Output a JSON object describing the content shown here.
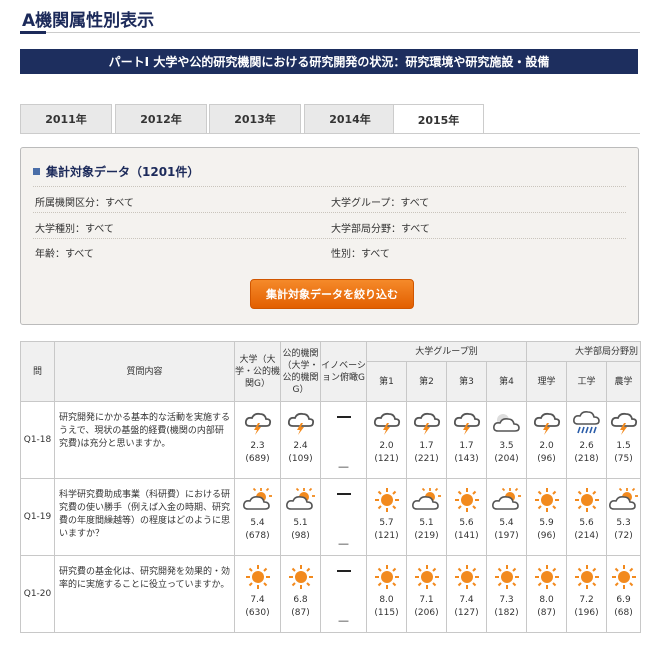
{
  "page": {
    "title": "A機関属性別表示",
    "banner": "パートI 大学や公的研究機関における研究開発の状況：研究環境や研究施設・設備"
  },
  "tabs": [
    {
      "label": "2011年",
      "active": false
    },
    {
      "label": "2012年",
      "active": false
    },
    {
      "label": "2013年",
      "active": false
    },
    {
      "label": "2014年",
      "active": false
    },
    {
      "label": "2015年",
      "active": true
    }
  ],
  "filters": {
    "heading": "集計対象データ（1201件）",
    "criteria": [
      "所属機関区分：すべて",
      "大学グループ：すべて",
      "大学種別：すべて",
      "大学部局分野：すべて",
      "年齢：すべて",
      "性別：すべて"
    ],
    "button": "集計対象データを絞り込む"
  },
  "table": {
    "headers": {
      "q": "問",
      "content": "質問内容",
      "univ": "大学（大学・公的機関G）",
      "public": "公的機関（大学・公的機関G）",
      "innov": "イノベーション俯瞰G",
      "group": "大学グループ別",
      "dept": "大学部局分野別",
      "g1": "第1",
      "g2": "第2",
      "g3": "第3",
      "g4": "第4",
      "d1": "理学",
      "d2": "工学",
      "d3": "農学"
    },
    "rows": [
      {
        "id": "Q1-18",
        "text": "研究開発にかかる基本的な活動を実施するうえで、現状の基盤的経費(機関の内部研究費)は充分と思いますか。",
        "cells": [
          {
            "icon": "thunder",
            "score": "2.3",
            "n": "(689)"
          },
          {
            "icon": "thunder",
            "score": "2.4",
            "n": "(109)"
          },
          {
            "icon": "none",
            "score": "—"
          },
          {
            "icon": "thunder",
            "score": "2.0",
            "n": "(121)"
          },
          {
            "icon": "thunder",
            "score": "1.7",
            "n": "(221)"
          },
          {
            "icon": "thunder",
            "score": "1.7",
            "n": "(143)"
          },
          {
            "icon": "cloud",
            "score": "3.5",
            "n": "(204)"
          },
          {
            "icon": "thunder",
            "score": "2.0",
            "n": "(96)"
          },
          {
            "icon": "rain",
            "score": "2.6",
            "n": "(218)"
          },
          {
            "icon": "thunder",
            "score": "1.5",
            "n": "(75)"
          }
        ]
      },
      {
        "id": "Q1-19",
        "text": "科学研究費助成事業（科研費）における研究費の使い勝手（例えば入金の時期、研究費の年度間繰越等）の程度はどのように思いますか？",
        "cells": [
          {
            "icon": "suncloud",
            "score": "5.4",
            "n": "(678)"
          },
          {
            "icon": "suncloud",
            "score": "5.1",
            "n": "(98)"
          },
          {
            "icon": "none",
            "score": "—"
          },
          {
            "icon": "sun",
            "score": "5.7",
            "n": "(121)"
          },
          {
            "icon": "suncloud",
            "score": "5.1",
            "n": "(219)"
          },
          {
            "icon": "sun",
            "score": "5.6",
            "n": "(141)"
          },
          {
            "icon": "suncloud",
            "score": "5.4",
            "n": "(197)"
          },
          {
            "icon": "sun",
            "score": "5.9",
            "n": "(96)"
          },
          {
            "icon": "sun",
            "score": "5.6",
            "n": "(214)"
          },
          {
            "icon": "suncloud",
            "score": "5.3",
            "n": "(72)"
          }
        ]
      },
      {
        "id": "Q1-20",
        "text": "研究費の基金化は、研究開発を効果的・効率的に実施することに役立っていますか。",
        "cells": [
          {
            "icon": "sun",
            "score": "7.4",
            "n": "(630)"
          },
          {
            "icon": "sun",
            "score": "6.8",
            "n": "(87)"
          },
          {
            "icon": "none",
            "score": "—"
          },
          {
            "icon": "sun",
            "score": "8.0",
            "n": "(115)"
          },
          {
            "icon": "sun",
            "score": "7.1",
            "n": "(206)"
          },
          {
            "icon": "sun",
            "score": "7.4",
            "n": "(127)"
          },
          {
            "icon": "sun",
            "score": "7.3",
            "n": "(182)"
          },
          {
            "icon": "sun",
            "score": "8.0",
            "n": "(87)"
          },
          {
            "icon": "sun",
            "score": "7.2",
            "n": "(196)"
          },
          {
            "icon": "sun",
            "score": "6.9",
            "n": "(68)"
          }
        ]
      }
    ]
  },
  "colors": {
    "navy": "#1d2e5e",
    "orange": "#e9660b",
    "sun": "#f28a1e",
    "cloud": "#555555"
  }
}
